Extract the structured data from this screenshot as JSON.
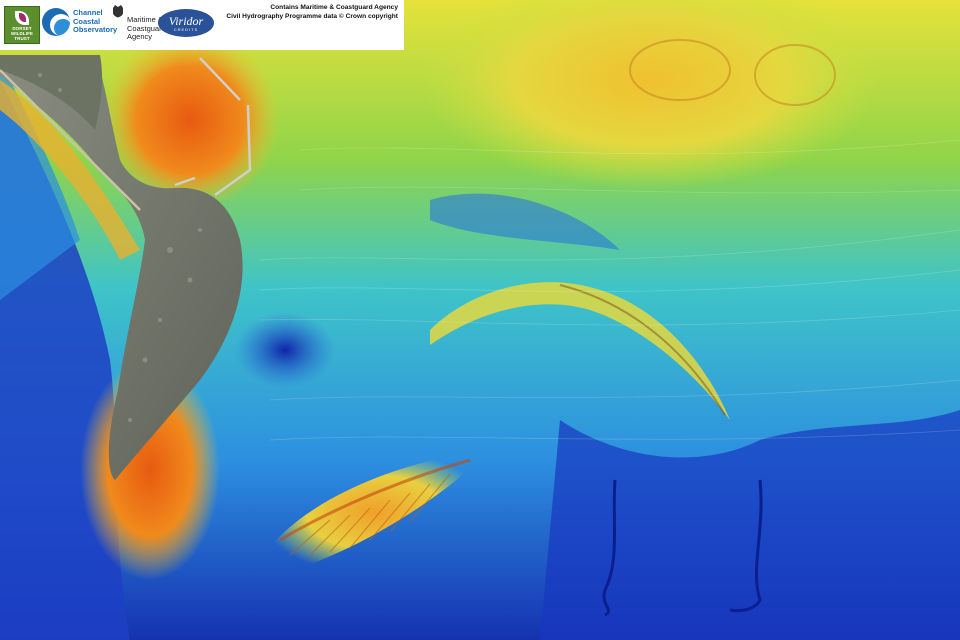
{
  "banner": {
    "logos": [
      {
        "id": "dorset-wildlife-trust",
        "text": "DORSET WILDLIFE TRUST"
      },
      {
        "id": "channel-coastal-observatory",
        "lines": [
          "Channel",
          "Coastal",
          "Observatory"
        ]
      },
      {
        "id": "maritime-coastguard-agency",
        "lines": [
          "Maritime &",
          "Coastguard",
          "Agency"
        ]
      },
      {
        "id": "viridor-credits",
        "name": "Viridor",
        "sub": "CREDITS"
      }
    ],
    "credit_lines": [
      "Contains Maritime & Coastguard Agency",
      "Civil Hydrography Programme data © Crown copyright"
    ]
  },
  "colors": {
    "deep": "#1534b8",
    "mid_deep": "#2a7be0",
    "mid": "#33c1d8",
    "shallow": "#d8e33a",
    "very_shallow": "#f0a020",
    "land": "#7a7d72"
  }
}
